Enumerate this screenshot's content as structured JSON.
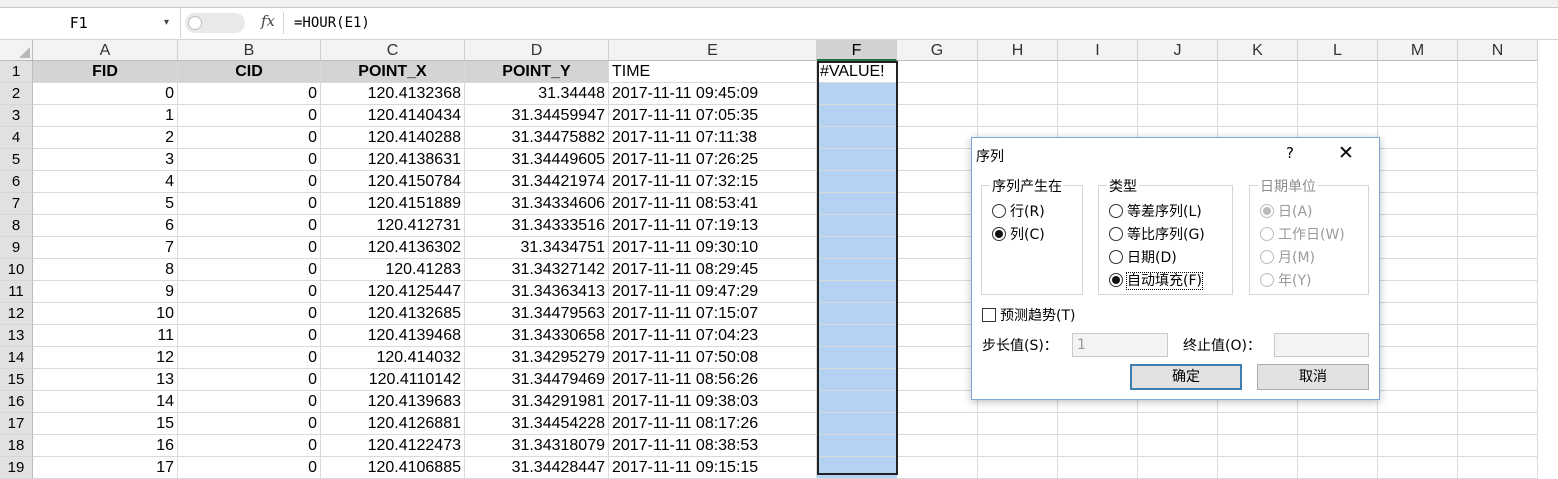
{
  "formula_bar": {
    "name_box": "F1",
    "name_arrow": "▾",
    "fx_label": "fx",
    "formula": "=HOUR(E1)"
  },
  "columns": [
    "A",
    "B",
    "C",
    "D",
    "E",
    "F",
    "G",
    "H",
    "I",
    "J",
    "K",
    "L",
    "M",
    "N"
  ],
  "header_row": {
    "A": "FID",
    "B": "CID",
    "C": "POINT_X",
    "D": "POINT_Y",
    "E": "TIME",
    "F": "#VALUE!"
  },
  "rows": [
    {
      "num": "2",
      "fid": "0",
      "cid": "0",
      "x": "120.4132368",
      "y": "31.34448",
      "time": "2017-11-11 09:45:09"
    },
    {
      "num": "3",
      "fid": "1",
      "cid": "0",
      "x": "120.4140434",
      "y": "31.34459947",
      "time": "2017-11-11 07:05:35"
    },
    {
      "num": "4",
      "fid": "2",
      "cid": "0",
      "x": "120.4140288",
      "y": "31.34475882",
      "time": "2017-11-11 07:11:38"
    },
    {
      "num": "5",
      "fid": "3",
      "cid": "0",
      "x": "120.4138631",
      "y": "31.34449605",
      "time": "2017-11-11 07:26:25"
    },
    {
      "num": "6",
      "fid": "4",
      "cid": "0",
      "x": "120.4150784",
      "y": "31.34421974",
      "time": "2017-11-11 07:32:15"
    },
    {
      "num": "7",
      "fid": "5",
      "cid": "0",
      "x": "120.4151889",
      "y": "31.34334606",
      "time": "2017-11-11 08:53:41"
    },
    {
      "num": "8",
      "fid": "6",
      "cid": "0",
      "x": "120.412731",
      "y": "31.34333516",
      "time": "2017-11-11 07:19:13"
    },
    {
      "num": "9",
      "fid": "7",
      "cid": "0",
      "x": "120.4136302",
      "y": "31.3434751",
      "time": "2017-11-11 09:30:10"
    },
    {
      "num": "10",
      "fid": "8",
      "cid": "0",
      "x": "120.41283",
      "y": "31.34327142",
      "time": "2017-11-11 08:29:45"
    },
    {
      "num": "11",
      "fid": "9",
      "cid": "0",
      "x": "120.4125447",
      "y": "31.34363413",
      "time": "2017-11-11 09:47:29"
    },
    {
      "num": "12",
      "fid": "10",
      "cid": "0",
      "x": "120.4132685",
      "y": "31.34479563",
      "time": "2017-11-11 07:15:07"
    },
    {
      "num": "13",
      "fid": "11",
      "cid": "0",
      "x": "120.4139468",
      "y": "31.34330658",
      "time": "2017-11-11 07:04:23"
    },
    {
      "num": "14",
      "fid": "12",
      "cid": "0",
      "x": "120.414032",
      "y": "31.34295279",
      "time": "2017-11-11 07:50:08"
    },
    {
      "num": "15",
      "fid": "13",
      "cid": "0",
      "x": "120.4110142",
      "y": "31.34479469",
      "time": "2017-11-11 08:56:26"
    },
    {
      "num": "16",
      "fid": "14",
      "cid": "0",
      "x": "120.4139683",
      "y": "31.34291981",
      "time": "2017-11-11 09:38:03"
    },
    {
      "num": "17",
      "fid": "15",
      "cid": "0",
      "x": "120.4126881",
      "y": "31.34454228",
      "time": "2017-11-11 08:17:26"
    },
    {
      "num": "18",
      "fid": "16",
      "cid": "0",
      "x": "120.4122473",
      "y": "31.34318079",
      "time": "2017-11-11 08:38:53"
    },
    {
      "num": "19",
      "fid": "17",
      "cid": "0",
      "x": "120.4106885",
      "y": "31.34428447",
      "time": "2017-11-11 09:15:15"
    }
  ],
  "dialog": {
    "title": "序列",
    "help": "?",
    "close": "✕",
    "series_in": {
      "legend": "序列产生在",
      "rows": "行(R)",
      "columns": "列(C)",
      "selected": "columns"
    },
    "type": {
      "legend": "类型",
      "linear": "等差序列(L)",
      "growth": "等比序列(G)",
      "date": "日期(D)",
      "autofill": "自动填充(F)",
      "selected": "autofill"
    },
    "date_unit": {
      "legend": "日期单位",
      "day": "日(A)",
      "weekday": "工作日(W)",
      "month": "月(M)",
      "year": "年(Y)",
      "selected": "day",
      "enabled": false
    },
    "trend_label": "预测趋势(T)",
    "trend_checked": false,
    "step_label": "步长值(S)：",
    "step_value": "1",
    "stop_label": "终止值(O)：",
    "stop_value": "",
    "ok": "确定",
    "cancel": "取消"
  }
}
